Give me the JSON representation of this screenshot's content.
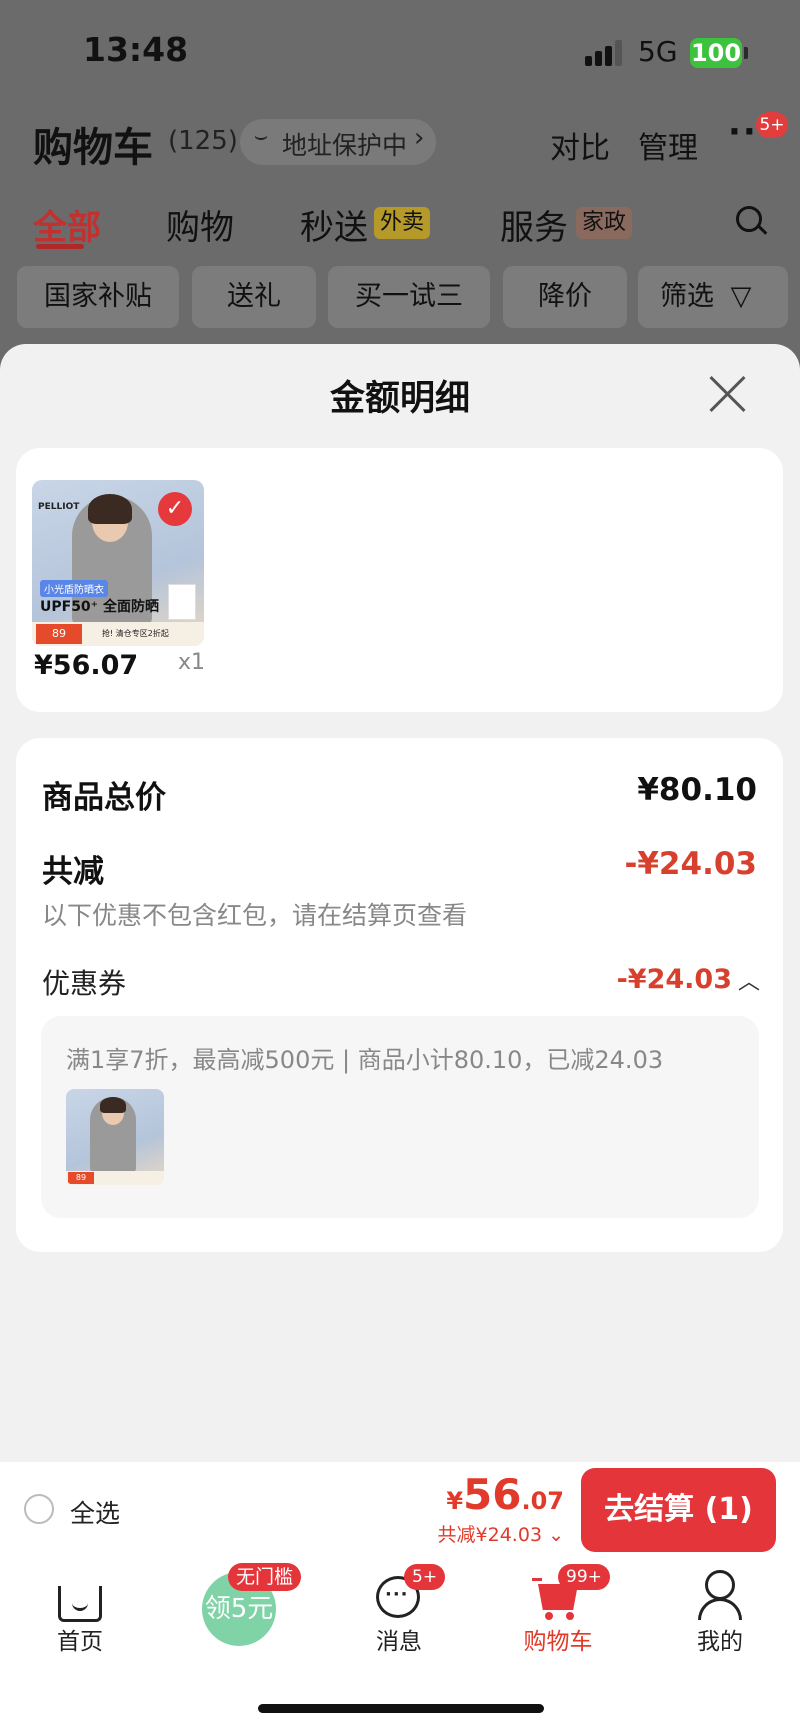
{
  "status_bar": {
    "time": "13:48",
    "network": "5G",
    "battery": "100"
  },
  "header": {
    "title": "购物车",
    "count": "(125)",
    "address_protect": "地址保护中",
    "compare": "对比",
    "manage": "管理",
    "more_badge": "5+"
  },
  "tabs": [
    {
      "label": "全部",
      "active": true
    },
    {
      "label": "购物"
    },
    {
      "label": "秒送",
      "tag": "外卖"
    },
    {
      "label": "服务",
      "tag": "家政"
    }
  ],
  "filters": [
    "国家补贴",
    "送礼",
    "买一试三",
    "降价",
    "筛选"
  ],
  "sheet": {
    "title": "金额明细",
    "item": {
      "price": "¥56.07",
      "qty": "x1",
      "image": {
        "brand": "PELLIOT",
        "tag": "小光盾防晒衣",
        "headline": "UPF50⁺ 全面防晒",
        "price_badge": "89",
        "promo": "抢! 清仓专区2折起"
      }
    },
    "summary": {
      "goods_total_label": "商品总价",
      "goods_total": "¥80.10",
      "discount_label": "共减",
      "discount": "-¥24.03",
      "note": "以下优惠不包含红包，请在结算页查看",
      "coupon_label": "优惠券",
      "coupon_amount": "-¥24.03",
      "coupon_desc": "满1享7折，最高减500元 | 商品小计80.10，已减24.03"
    }
  },
  "checkout": {
    "select_all": "全选",
    "currency": "¥",
    "total_int": "56",
    "total_dec": ".07",
    "total_off": "共减¥24.03",
    "pay_button": "去结算 (1)"
  },
  "tabbar": {
    "home": "首页",
    "coupon_badge": "无门槛",
    "coupon_text": "领5元",
    "messages": "消息",
    "messages_badge": "5+",
    "cart": "购物车",
    "cart_badge": "99+",
    "me": "我的"
  },
  "colors": {
    "accent": "#e4353a",
    "discount": "#d8402e",
    "coin": "#7fd3a6"
  }
}
